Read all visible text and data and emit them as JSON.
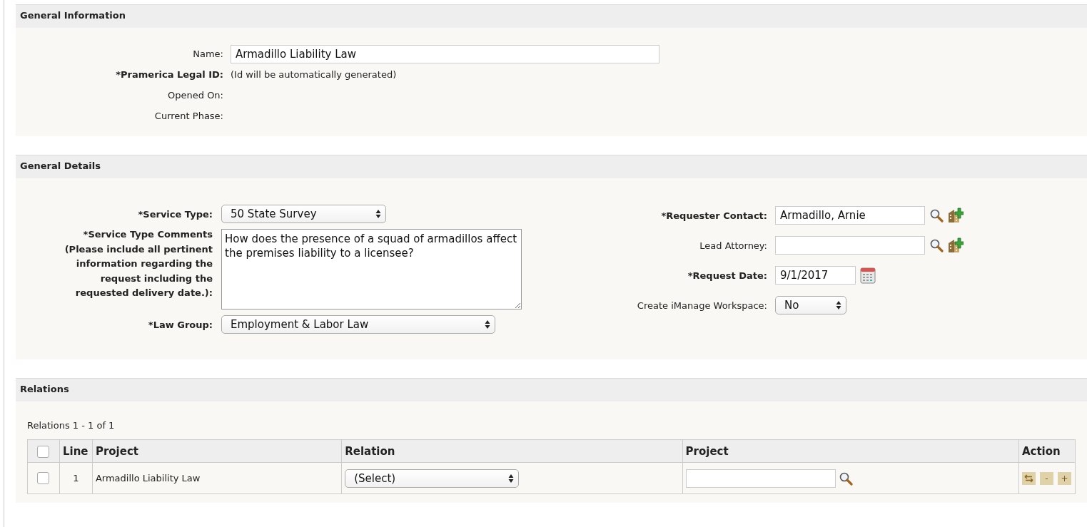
{
  "general_information": {
    "title": "General Information",
    "fields": [
      {
        "label": "Name:",
        "required": false,
        "kind": "text-input",
        "value": "Armadillo Liability Law"
      },
      {
        "label": "*Pramerica Legal ID:",
        "required": true,
        "kind": "text",
        "value": "(Id will be automatically generated)"
      },
      {
        "label": "Opened On:",
        "required": false,
        "kind": "empty"
      },
      {
        "label": "Current Phase:",
        "required": false,
        "kind": "empty"
      }
    ]
  },
  "general_details": {
    "title": "General Details",
    "left_fields": [
      {
        "label": "*Service Type:",
        "required": true,
        "kind": "select",
        "value": "50 State Survey"
      },
      {
        "label": "*Service Type Comments (Please include all pertinent information regarding the request including the requested delivery date.):",
        "required": true,
        "kind": "textarea",
        "value": "How does the presence of a squad of armadillos affect the premises liability to a licensee?"
      },
      {
        "label": "*Law Group:",
        "required": true,
        "kind": "select-wide",
        "value": "Employment & Labor Law"
      }
    ],
    "right_fields": [
      {
        "label": "*Requester Contact:",
        "required": true,
        "kind": "lookup",
        "value": "Armadillo, Arnie"
      },
      {
        "label": "Lead Attorney:",
        "required": false,
        "kind": "lookup"
      },
      {
        "label": "*Request Date:",
        "required": true,
        "kind": "date",
        "value": "9/1/2017"
      },
      {
        "label": "Create iManage Workspace:",
        "required": false,
        "kind": "select-small",
        "value": "No"
      }
    ]
  },
  "relations": {
    "title": "Relations",
    "summary": "Relations 1 - 1 of 1",
    "table": {
      "select_all_checked": false,
      "columns": [
        "Line",
        "Project",
        "Relation",
        "Project",
        "Action"
      ],
      "rows": [
        {
          "checked": false,
          "line": "1",
          "project": "Armadillo Liability Law",
          "relation": "(Select)",
          "action_buttons": [
            "-",
            "+"
          ]
        }
      ]
    }
  }
}
